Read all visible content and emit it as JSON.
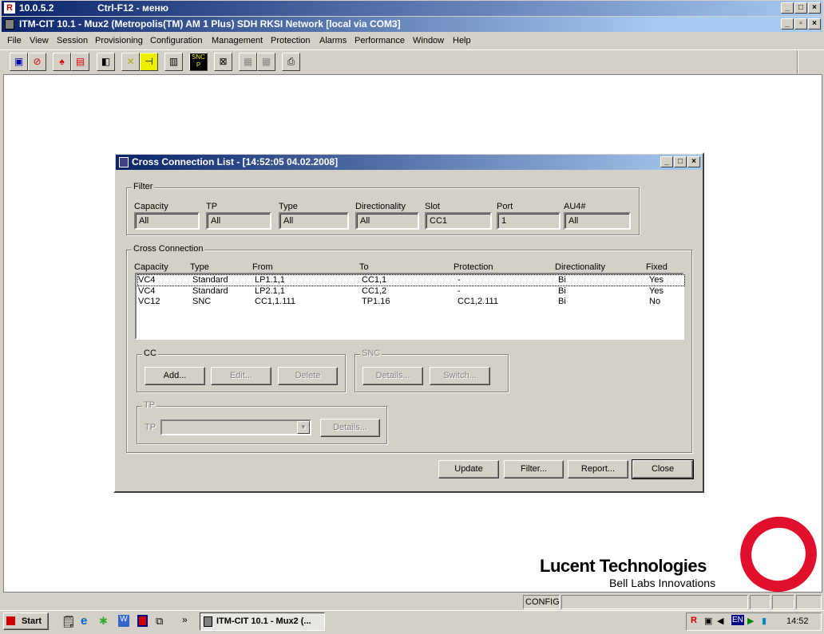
{
  "outer_title": {
    "host": "10.0.5.2",
    "hint": "Ctrl-F12 - меню"
  },
  "app_title": "ITM-CIT 10.1 - Mux2 (Metropolis(TM) AM 1 Plus) SDH RKSI Network [local via COM3]",
  "menu": [
    "File",
    "View",
    "Session",
    "Provisioning",
    "Configuration",
    "Management",
    "Protection",
    "Alarms",
    "Performance",
    "Window",
    "Help"
  ],
  "toolbar": [
    "connect-icon",
    "disconnect-icon",
    "alarm-bell-icon",
    "alarm-list-icon",
    "ne-icon",
    "cross-connect-icon",
    "port-icon",
    "equipment-icon",
    "sncp-icon",
    "report-icon",
    "slot-a-icon",
    "slot-b-icon",
    "print-icon"
  ],
  "toolbar_sncp_text": "SNC P",
  "dialog": {
    "title": "Cross Connection List - [14:52:05 04.02.2008]",
    "filter": {
      "label": "Filter",
      "fields": [
        {
          "label": "Capacity",
          "value": "All"
        },
        {
          "label": "TP",
          "value": "All"
        },
        {
          "label": "Type",
          "value": "All"
        },
        {
          "label": "Directionality",
          "value": "All"
        },
        {
          "label": "Slot",
          "value": "CC1"
        },
        {
          "label": "Port",
          "value": "1"
        },
        {
          "label": "AU4#",
          "value": "All"
        }
      ]
    },
    "cross_connection": {
      "label": "Cross Connection",
      "columns": [
        "Capacity",
        "Type",
        "From",
        "To",
        "Protection",
        "Directionality",
        "Fixed"
      ],
      "rows": [
        [
          "VC4",
          "Standard",
          "LP1.1,1",
          "CC1,1",
          "-",
          "Bi",
          "Yes"
        ],
        [
          "VC4",
          "Standard",
          "LP2.1,1",
          "CC1,2",
          "-",
          "Bi",
          "Yes"
        ],
        [
          "VC12",
          "SNC",
          "CC1,1.111",
          "TP1.16",
          "CC1,2.111",
          "Bi",
          "No"
        ]
      ]
    },
    "cc": {
      "label": "CC",
      "add": "Add...",
      "edit": "Edit...",
      "delete": "Delete"
    },
    "snc": {
      "label": "SNC",
      "details": "Details...",
      "switch": "Switch..."
    },
    "tp": {
      "label": "TP",
      "field_label": "TP",
      "details": "Details..."
    },
    "buttons": {
      "update": "Update",
      "filter": "Filter...",
      "report": "Report...",
      "close": "Close"
    }
  },
  "logo": {
    "company": "Lucent Technologies",
    "tagline": "Bell Labs Innovations"
  },
  "status": {
    "mode": "CONFIG"
  },
  "taskbar": {
    "start": "Start",
    "task": "ITM-CIT 10.1 - Mux2 (...",
    "lang": "EN",
    "time": "14:52",
    "more": "»"
  }
}
